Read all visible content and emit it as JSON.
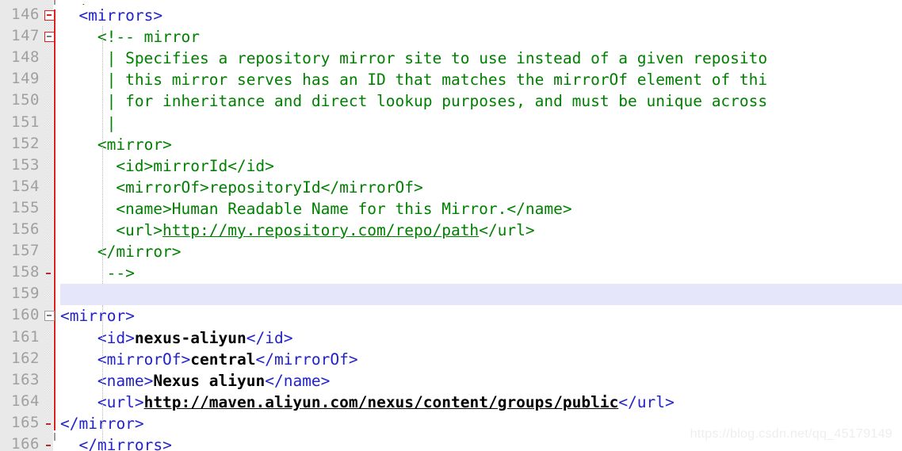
{
  "editor": {
    "first_visible_line": 146,
    "highlighted_line": 159,
    "watermark": "https://blog.csdn.net/qq_45179149",
    "clipped_top_fragment": "  |"
  },
  "colors": {
    "tag": "#2222cc",
    "comment": "#008000",
    "value": "#000000",
    "gutter_background": "#e9e9e9",
    "line_number": "#a0a0a0",
    "change_bar": "#e02020",
    "highlight_row": "#e6e6fa",
    "editor_background": "#ffffff",
    "watermark": "#eeeeee"
  },
  "lines": [
    {
      "number": "146",
      "indent": 2,
      "fold": "red-box-red-minus",
      "segments": [
        {
          "text": "<mirrors>",
          "style": "tag"
        }
      ]
    },
    {
      "number": "147",
      "indent": 4,
      "fold": "red-box-gray-minus",
      "segments": [
        {
          "text": "<!-- mirror",
          "style": "comment"
        }
      ]
    },
    {
      "number": "148",
      "indent": 5,
      "fold": "none",
      "segments": [
        {
          "text": "| Specifies a repository mirror site to use instead of a given reposito",
          "style": "comment"
        }
      ]
    },
    {
      "number": "149",
      "indent": 5,
      "fold": "none",
      "segments": [
        {
          "text": "| this mirror serves has an ID that matches the mirrorOf element of thi",
          "style": "comment"
        }
      ]
    },
    {
      "number": "150",
      "indent": 5,
      "fold": "none",
      "segments": [
        {
          "text": "| for inheritance and direct lookup purposes, and must be unique across",
          "style": "comment"
        }
      ]
    },
    {
      "number": "151",
      "indent": 5,
      "fold": "none",
      "segments": [
        {
          "text": "|",
          "style": "comment"
        }
      ]
    },
    {
      "number": "152",
      "indent": 4,
      "fold": "none",
      "segments": [
        {
          "text": "<mirror>",
          "style": "comment"
        }
      ]
    },
    {
      "number": "153",
      "indent": 6,
      "fold": "none",
      "segments": [
        {
          "text": "<id>mirrorId</id>",
          "style": "comment"
        }
      ]
    },
    {
      "number": "154",
      "indent": 6,
      "fold": "none",
      "segments": [
        {
          "text": "<mirrorOf>repositoryId</mirrorOf>",
          "style": "comment"
        }
      ]
    },
    {
      "number": "155",
      "indent": 6,
      "fold": "none",
      "segments": [
        {
          "text": "<name>Human Readable Name for this Mirror.</name>",
          "style": "comment"
        }
      ]
    },
    {
      "number": "156",
      "indent": 6,
      "fold": "none",
      "segments": [
        {
          "text": "<url>",
          "style": "comment"
        },
        {
          "text": "http://my.repository.com/repo/path",
          "style": "comment-link"
        },
        {
          "text": "</url>",
          "style": "comment"
        }
      ]
    },
    {
      "number": "157",
      "indent": 4,
      "fold": "none",
      "segments": [
        {
          "text": "</mirror>",
          "style": "comment"
        }
      ]
    },
    {
      "number": "158",
      "indent": 5,
      "fold": "dash",
      "segments": [
        {
          "text": "-->",
          "style": "comment"
        }
      ]
    },
    {
      "number": "159",
      "indent": 0,
      "fold": "none",
      "segments": []
    },
    {
      "number": "160",
      "indent": 0,
      "fold": "gray-box-gray-minus",
      "segments": [
        {
          "text": "<mirror>",
          "style": "tag"
        }
      ]
    },
    {
      "number": "161",
      "indent": 4,
      "fold": "none",
      "segments": [
        {
          "text": "<id>",
          "style": "tag"
        },
        {
          "text": "nexus-aliyun",
          "style": "val"
        },
        {
          "text": "</id>",
          "style": "tag"
        }
      ]
    },
    {
      "number": "162",
      "indent": 4,
      "fold": "none",
      "segments": [
        {
          "text": "<mirrorOf>",
          "style": "tag"
        },
        {
          "text": "central",
          "style": "val"
        },
        {
          "text": "</mirrorOf>",
          "style": "tag"
        }
      ]
    },
    {
      "number": "163",
      "indent": 4,
      "fold": "none",
      "segments": [
        {
          "text": "<name>",
          "style": "tag"
        },
        {
          "text": "Nexus aliyun",
          "style": "val"
        },
        {
          "text": "</name>",
          "style": "tag"
        }
      ]
    },
    {
      "number": "164",
      "indent": 4,
      "fold": "none",
      "segments": [
        {
          "text": "<url>",
          "style": "tag"
        },
        {
          "text": "http://maven.aliyun.com/nexus/content/groups/public",
          "style": "val-link"
        },
        {
          "text": "</url>",
          "style": "tag"
        }
      ]
    },
    {
      "number": "165",
      "indent": 0,
      "fold": "dash",
      "segments": [
        {
          "text": "</mirror>",
          "style": "tag"
        }
      ]
    },
    {
      "number": "166",
      "indent": 2,
      "fold": "dash",
      "segments": [
        {
          "text": "</mirrors>",
          "style": "tag"
        }
      ]
    }
  ]
}
